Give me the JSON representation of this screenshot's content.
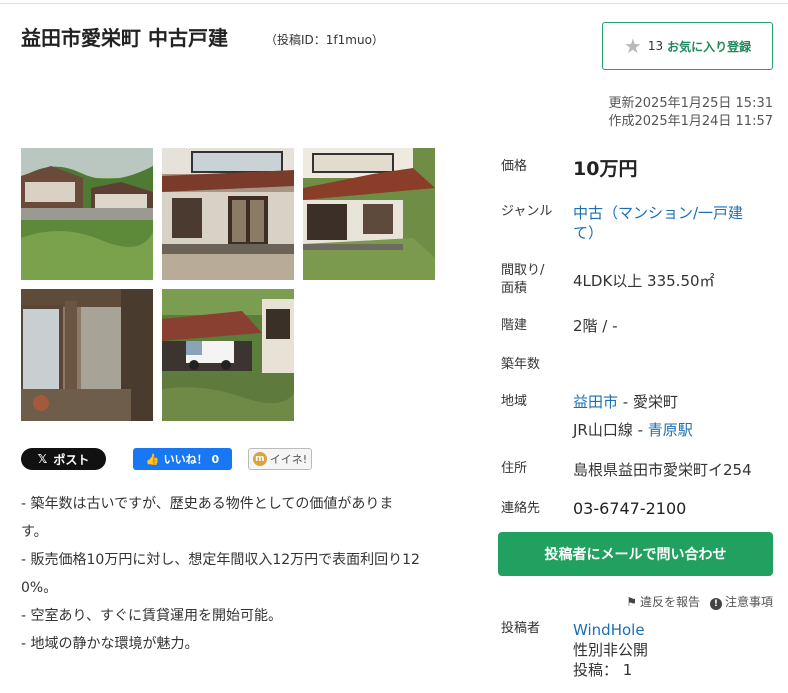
{
  "header": {
    "title": "益田市愛栄町 中古戸建",
    "post_id": "（投稿ID：1f1muo）"
  },
  "favorite": {
    "count": "13",
    "label": "お気に入り登録",
    "icon": "star-icon"
  },
  "dates": {
    "updated": "更新2025年1月25日 15:31",
    "created": "作成2025年1月24日 11:57"
  },
  "photos": [
    {
      "name": "photo-house-exterior-hillside"
    },
    {
      "name": "photo-house-front-windows"
    },
    {
      "name": "photo-house-side-roof"
    },
    {
      "name": "photo-interior-corridor"
    },
    {
      "name": "photo-yard-with-truck"
    }
  ],
  "share": {
    "x_label": "ポスト",
    "fb_label": "いいね！ 0",
    "mixi_label": "イイネ!"
  },
  "description": [
    "- 築年数は古いですが、歴史ある物件としての価値がありま",
    "す。",
    "- 販売価格10万円に対し、想定年間収入12万円で表面利回り12",
    "0%。",
    "- 空室あり、すぐに賃貸運用を開始可能。",
    "- 地域の静かな環境が魅力。"
  ],
  "specs": {
    "price_label": "価格",
    "price_value": "10万円",
    "genre_label": "ジャンル",
    "genre_value_1": "中古（マンション/一戸建",
    "genre_value_2": "て）",
    "layout_label_1": "間取り/",
    "layout_label_2": "面積",
    "layout_value": "4LDK以上 335.50㎡",
    "floor_label": "階建",
    "floor_value": "2階 / -",
    "age_label": "築年数",
    "area_label": "地域",
    "area_city": "益田市",
    "area_sep": " - 愛栄町",
    "area_line": "JR山口線 - ",
    "area_station": "青原駅",
    "address_label": "住所",
    "address_value": "島根県益田市愛栄町イ254",
    "contact_label": "連絡先",
    "contact_value": "03-6747-2100"
  },
  "contact_button": "投稿者にメールで問い合わせ",
  "report": {
    "violation": "違反を報告",
    "notice": "注意事項"
  },
  "poster": {
    "label": "投稿者",
    "name": "WindHole",
    "gender": "性別非公開",
    "posts": "投稿： 1"
  }
}
